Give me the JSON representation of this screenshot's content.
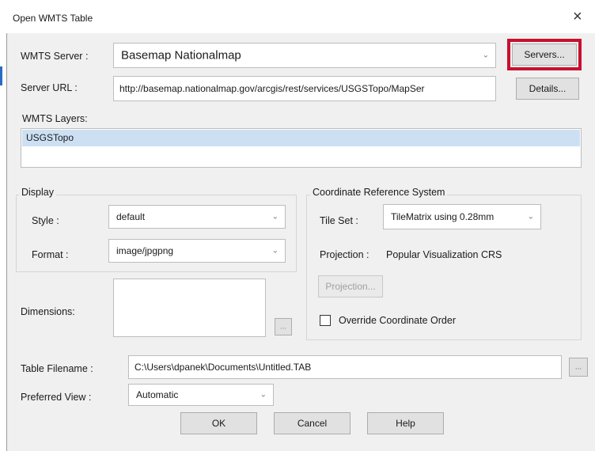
{
  "dialog": {
    "title": "Open WMTS Table",
    "close_glyph": "×"
  },
  "server": {
    "label": "WMTS Server :",
    "value": "Basemap Nationalmap",
    "servers_button": "Servers..."
  },
  "url": {
    "label": "Server URL :",
    "value": "http://basemap.nationalmap.gov/arcgis/rest/services/USGSTopo/MapSer",
    "details_button": "Details..."
  },
  "layers": {
    "label": "WMTS Layers:",
    "items": [
      "USGSTopo"
    ]
  },
  "display": {
    "title": "Display",
    "style_label": "Style :",
    "style_value": "default",
    "format_label": "Format :",
    "format_value": "image/jpgpng"
  },
  "crs": {
    "title": "Coordinate Reference System",
    "tileset_label": "Tile Set :",
    "tileset_value": "TileMatrix using 0.28mm",
    "projection_label": "Projection :",
    "projection_value": "Popular Visualization CRS",
    "projection_button": "Projection...",
    "override_label": "Override Coordinate Order"
  },
  "dimensions": {
    "label": "Dimensions:",
    "browse_button": "..."
  },
  "table": {
    "label": "Table Filename :",
    "value": "C:\\Users\\dpanek\\Documents\\Untitled.TAB",
    "browse_button": "..."
  },
  "view": {
    "label": "Preferred View :",
    "value": "Automatic"
  },
  "actions": {
    "ok": "OK",
    "cancel": "Cancel",
    "help": "Help"
  },
  "icons": {
    "chevron": "⌄"
  },
  "colors": {
    "highlight": "#c8102e",
    "selection": "#cde0f3",
    "accent": "#2a6cc4"
  }
}
